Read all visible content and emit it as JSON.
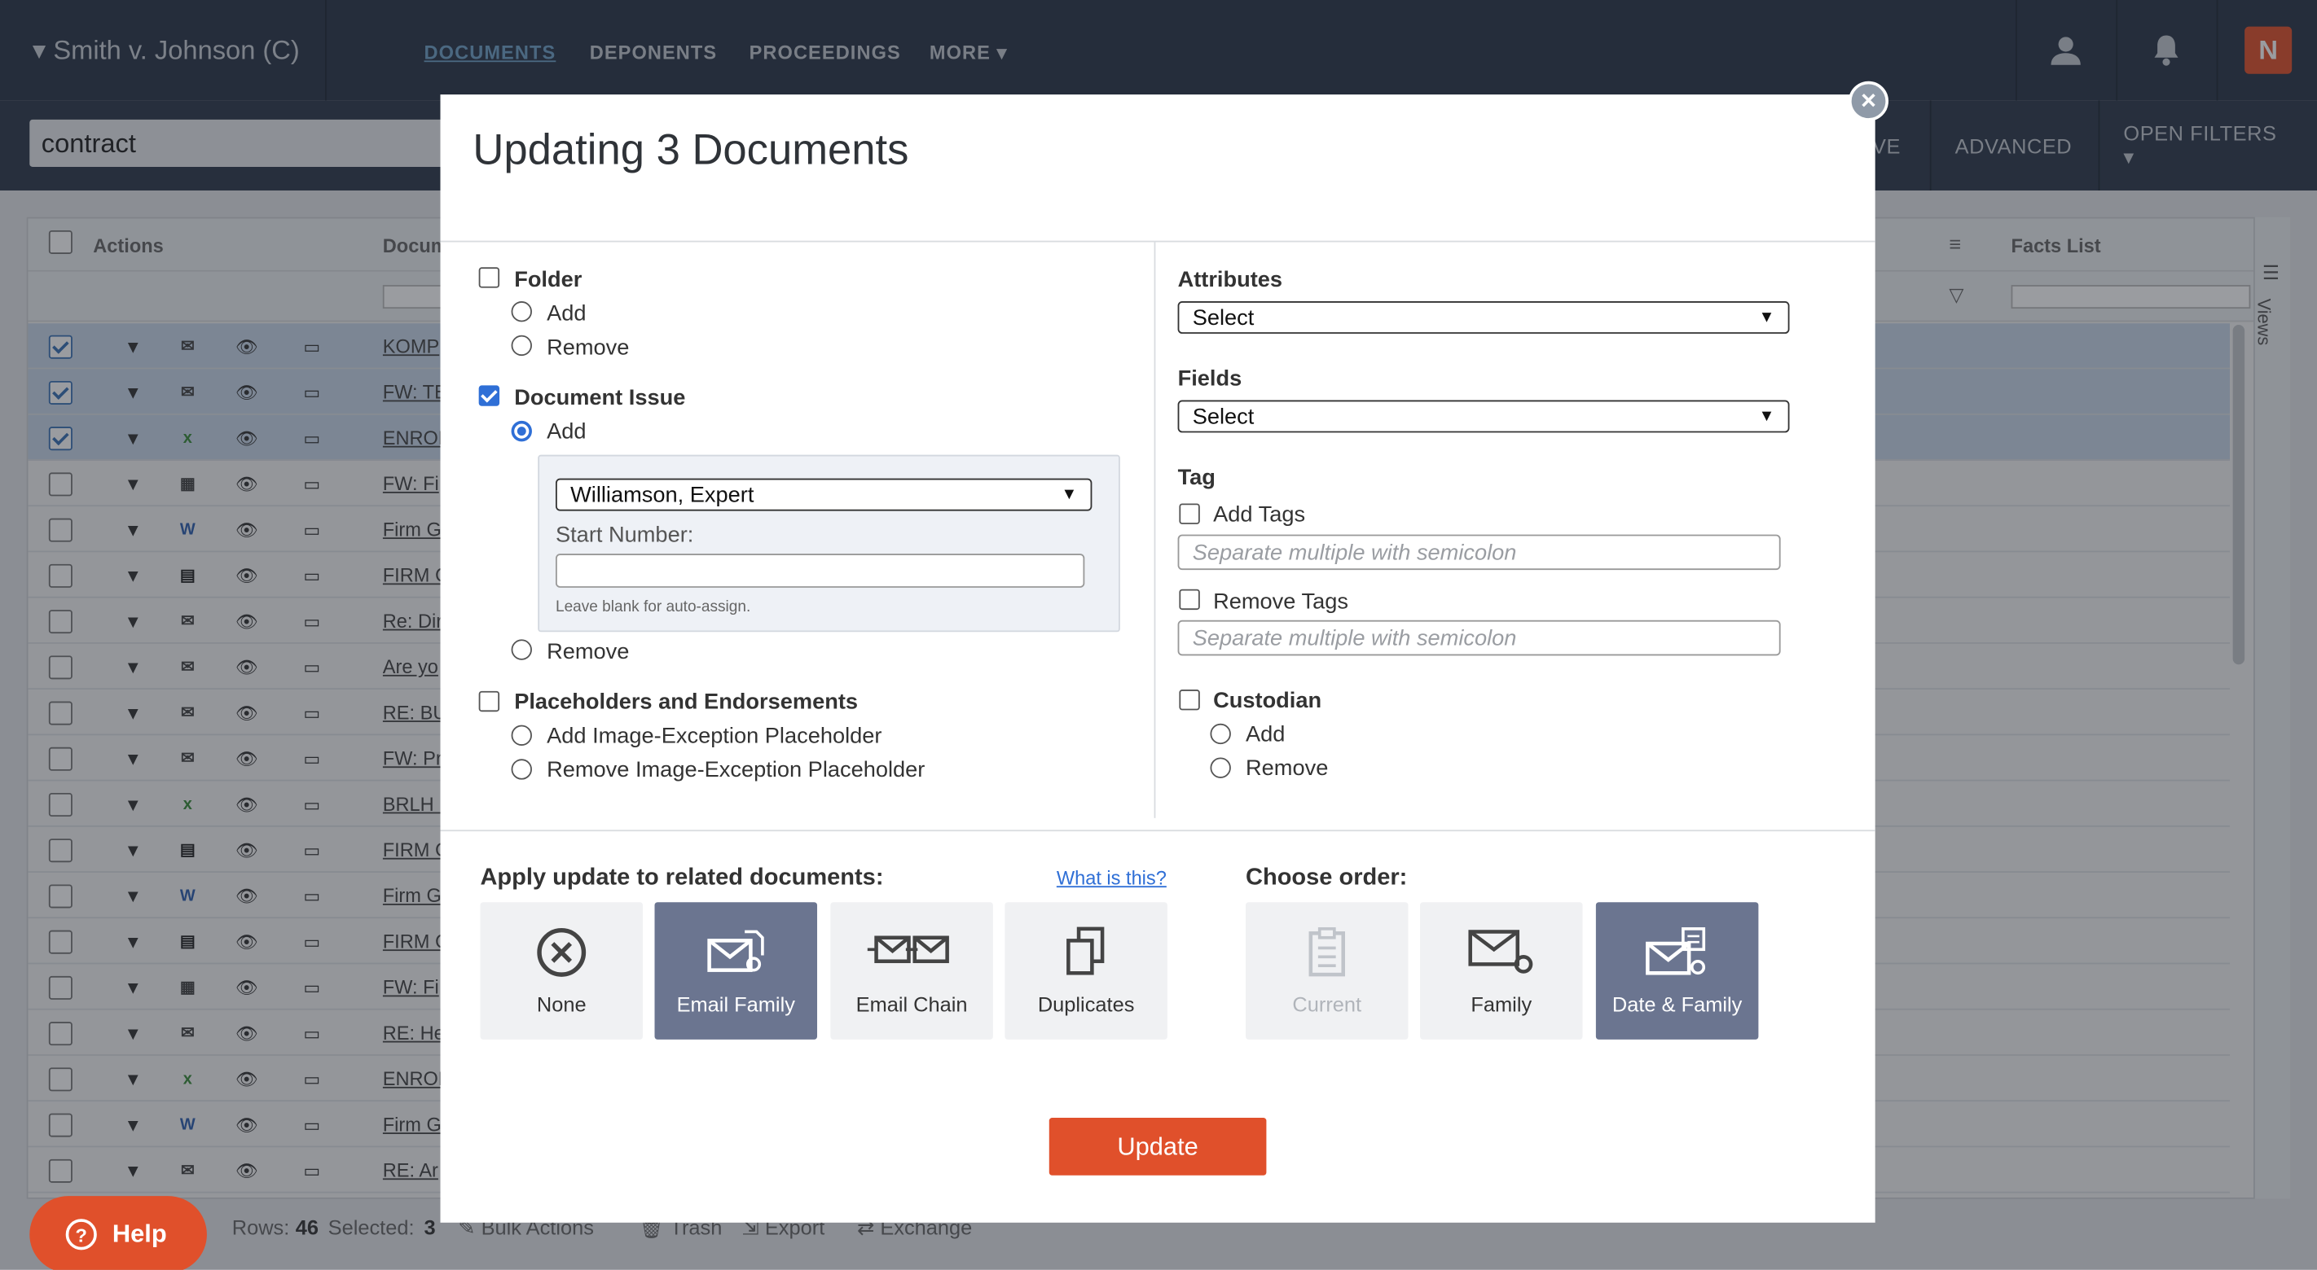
{
  "header": {
    "case_title": "▾ Smith v. Johnson (C)",
    "nav": [
      "DOCUMENTS",
      "DEPONENTS",
      "PROCEEDINGS",
      "MORE ▾"
    ],
    "logo_letter": "N"
  },
  "search": {
    "value": "contract"
  },
  "subbar": {
    "buttons": [
      "VE",
      "ADVANCED",
      "OPEN FILTERS ▾"
    ]
  },
  "grid": {
    "headers": {
      "actions": "Actions",
      "document": "Docum",
      "facts_list": "Facts List",
      "views": "Views"
    },
    "rows": [
      {
        "name": "KOMP",
        "selected": true,
        "icon": "email-icon"
      },
      {
        "name": "FW: TE",
        "selected": true,
        "icon": "email-icon"
      },
      {
        "name": "ENRON",
        "selected": true,
        "icon": "excel-icon"
      },
      {
        "name": "FW: Fi",
        "selected": false,
        "icon": "image-icon"
      },
      {
        "name": "Firm G",
        "selected": false,
        "icon": "word-icon"
      },
      {
        "name": "FIRM C",
        "selected": false,
        "icon": "doc-icon"
      },
      {
        "name": "Re: Dir",
        "selected": false,
        "icon": "email-icon"
      },
      {
        "name": "Are yo",
        "selected": false,
        "icon": "email-icon"
      },
      {
        "name": "RE: BU",
        "selected": false,
        "icon": "email-icon"
      },
      {
        "name": "FW: Pr",
        "selected": false,
        "icon": "email-icon"
      },
      {
        "name": "BRLH :",
        "selected": false,
        "icon": "excel-icon"
      },
      {
        "name": "FIRM C",
        "selected": false,
        "icon": "doc-icon"
      },
      {
        "name": "Firm G",
        "selected": false,
        "icon": "word-icon"
      },
      {
        "name": "FIRM C",
        "selected": false,
        "icon": "doc-icon"
      },
      {
        "name": "FW: Fi",
        "selected": false,
        "icon": "image-icon"
      },
      {
        "name": "RE: He",
        "selected": false,
        "icon": "email-icon"
      },
      {
        "name": "ENRON",
        "selected": false,
        "icon": "excel-icon"
      },
      {
        "name": "Firm G",
        "selected": false,
        "icon": "word-icon"
      },
      {
        "name": "RE: Ar",
        "selected": false,
        "icon": "email-icon"
      }
    ]
  },
  "footer": {
    "rows_label": "Rows:",
    "rows_value": "46",
    "selected_label": "Selected:",
    "selected_value": "3",
    "actions": [
      "Bulk Actions",
      "Trash",
      "Export",
      "Exchange"
    ]
  },
  "help": {
    "label": "Help"
  },
  "modal": {
    "title": "Updating 3 Documents",
    "folder": {
      "label": "Folder",
      "checked": false,
      "add": "Add",
      "remove": "Remove"
    },
    "document_issue": {
      "label": "Document Issue",
      "checked": true,
      "add": "Add",
      "remove": "Remove",
      "selected_value": "Williamson, Expert",
      "start_number_label": "Start Number:",
      "start_number_value": "",
      "hint": "Leave blank for auto-assign."
    },
    "placeholders": {
      "label": "Placeholders and Endorsements",
      "checked": false,
      "add": "Add Image-Exception Placeholder",
      "remove": "Remove Image-Exception Placeholder"
    },
    "attributes": {
      "label": "Attributes",
      "value": "Select"
    },
    "fields": {
      "label": "Fields",
      "value": "Select"
    },
    "tag": {
      "label": "Tag",
      "add_label": "Add Tags",
      "add_placeholder": "Separate multiple with semicolon",
      "remove_label": "Remove Tags",
      "remove_placeholder": "Separate multiple with semicolon"
    },
    "custodian": {
      "label": "Custodian",
      "checked": false,
      "add": "Add",
      "remove": "Remove"
    },
    "related": {
      "label": "Apply update to related documents:",
      "help_link": "What is this?",
      "options": [
        {
          "label": "None",
          "selected": false,
          "icon": "none-circle-x-icon"
        },
        {
          "label": "Email Family",
          "selected": true,
          "icon": "email-family-icon"
        },
        {
          "label": "Email Chain",
          "selected": false,
          "icon": "email-chain-icon"
        },
        {
          "label": "Duplicates",
          "selected": false,
          "icon": "duplicates-icon"
        }
      ]
    },
    "order": {
      "label": "Choose order:",
      "options": [
        {
          "label": "Current",
          "selected": false,
          "disabled": true,
          "icon": "clipboard-icon"
        },
        {
          "label": "Family",
          "selected": false,
          "disabled": false,
          "icon": "family-email-icon"
        },
        {
          "label": "Date & Family",
          "selected": true,
          "disabled": false,
          "icon": "date-family-icon"
        }
      ]
    },
    "update_button": "Update"
  },
  "colors": {
    "accent": "#e0502b",
    "selected_option": "#6b7590",
    "topbar": "#2b3648",
    "link": "#2f6fd6"
  }
}
